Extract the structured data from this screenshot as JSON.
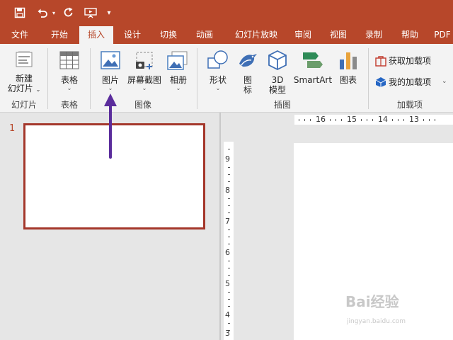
{
  "qat": {
    "customize_label": "▾"
  },
  "tabs": [
    {
      "label": "文件"
    },
    {
      "label": "开始"
    },
    {
      "label": "插入",
      "active": true
    },
    {
      "label": "设计"
    },
    {
      "label": "切换"
    },
    {
      "label": "动画"
    },
    {
      "label": "幻灯片放映"
    },
    {
      "label": "审阅"
    },
    {
      "label": "视图"
    },
    {
      "label": "录制"
    },
    {
      "label": "帮助"
    },
    {
      "label": "PDF"
    }
  ],
  "ribbon": {
    "new_slide": {
      "line1": "新建",
      "line2": "幻灯片"
    },
    "table": {
      "label": "表格"
    },
    "picture": {
      "label": "图片"
    },
    "screenshot": {
      "label": "屏幕截图"
    },
    "album": {
      "label": "相册"
    },
    "shapes": {
      "label": "形状"
    },
    "icons": {
      "line1": "图",
      "line2": "标"
    },
    "model3d": {
      "line1": "3D",
      "line2": "模型"
    },
    "smartart": {
      "label": "SmartArt"
    },
    "chart": {
      "label": "图表"
    },
    "get_addins": {
      "label": "获取加载项"
    },
    "my_addins": {
      "label": "我的加载项"
    },
    "groups": {
      "slides": "幻灯片",
      "tables": "表格",
      "images": "图像",
      "illustrations": "插图",
      "addins": "加载项"
    }
  },
  "slides_panel": {
    "slide_number": "1"
  },
  "ruler": {
    "horizontal": [
      "16",
      "15",
      "14",
      "13"
    ],
    "vertical": [
      "9",
      "8",
      "7",
      "6",
      "5",
      "4",
      "3"
    ]
  },
  "watermark": {
    "text": "Bai经验",
    "sub": "jingyan.baidu.com"
  },
  "colors": {
    "accent": "#b7472a",
    "arrow": "#5b2d9c"
  }
}
